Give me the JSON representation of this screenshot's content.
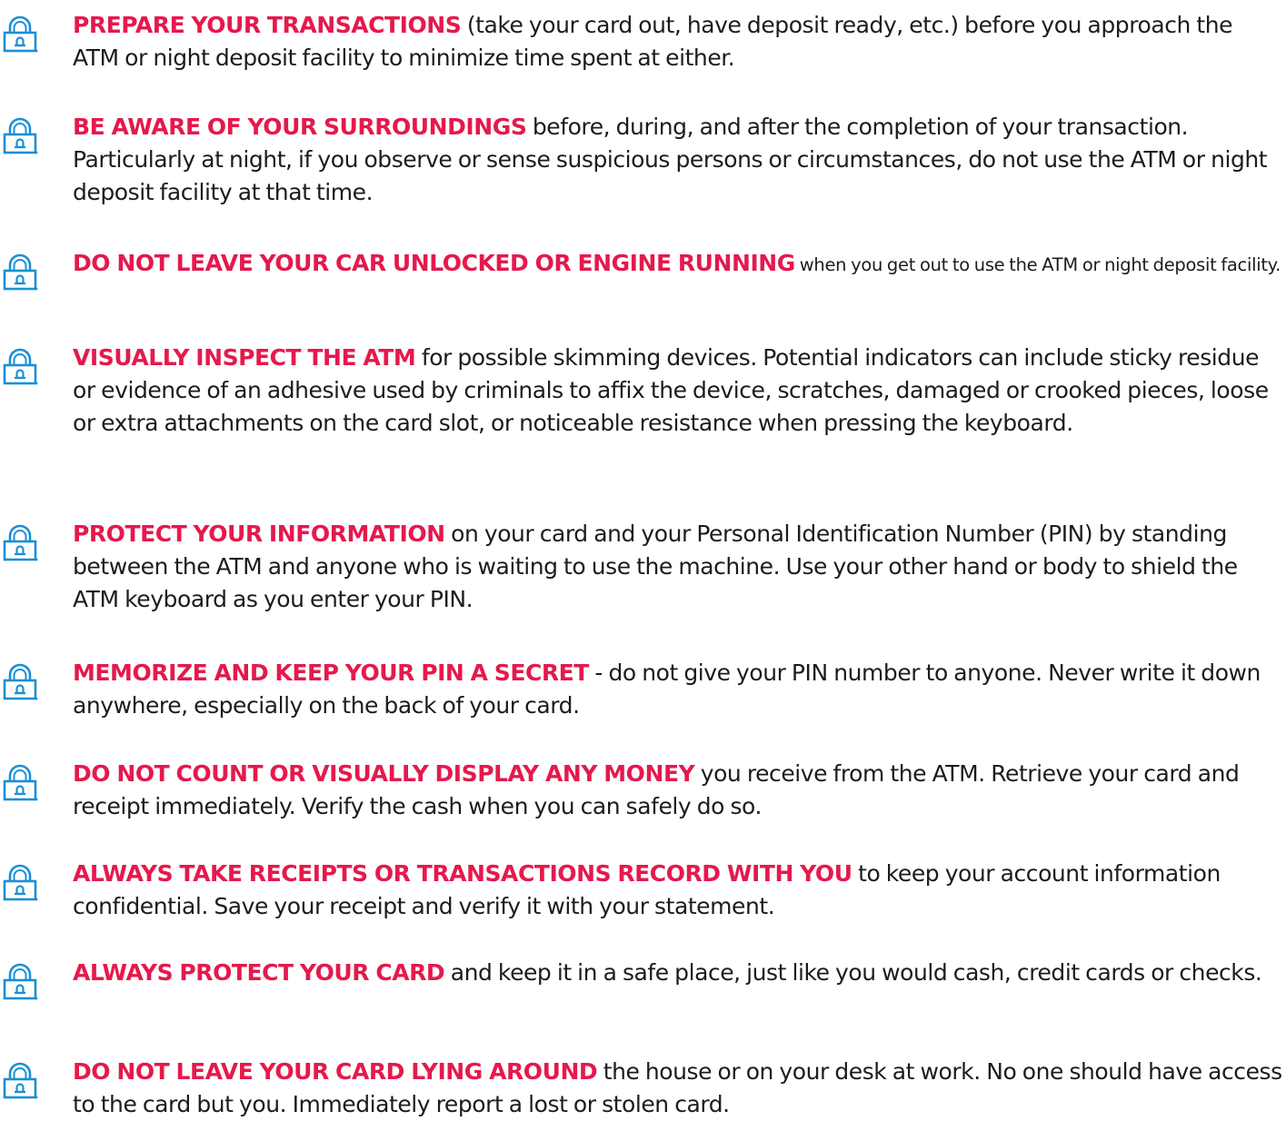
{
  "accent_color": "#e5194c",
  "icon_color": "#1a8fd6",
  "tips": [
    {
      "icon": "padlock-icon",
      "heading": "PREPARE YOUR TRANSACTIONS",
      "body": " (take your card out, have deposit ready, etc.) before you approach the ATM or night deposit facility to minimize time spent at either."
    },
    {
      "icon": "padlock-icon",
      "heading": "BE AWARE OF YOUR SURROUNDINGS",
      "body": " before, during, and after the completion of your transaction. Particularly at night, if you observe or sense suspicious persons or circumstances, do not use the ATM or night deposit facility at that time."
    },
    {
      "icon": "padlock-icon",
      "heading": "DO NOT LEAVE YOUR CAR UNLOCKED OR ENGINE RUNNING",
      "body": " when you get out to use the ATM or night deposit facility."
    },
    {
      "icon": "padlock-icon",
      "heading": "VISUALLY INSPECT THE ATM",
      "body": " for possible skimming devices. Potential indicators can include sticky residue or evidence of an adhesive used by criminals to affix the device, scratches, damaged or crooked pieces, loose or extra attachments on the card slot, or noticeable resistance when pressing the keyboard."
    },
    {
      "icon": "padlock-icon",
      "heading": "PROTECT YOUR INFORMATION",
      "body": " on your card and your Personal Identification Number (PIN) by standing between the ATM and anyone who is waiting to use the machine. Use your other hand or body to shield the ATM keyboard as you enter your PIN."
    },
    {
      "icon": "padlock-icon",
      "heading": "MEMORIZE AND KEEP YOUR PIN A SECRET",
      "body": " - do not give your PIN number to anyone. Never write it down anywhere, especially on the back of your card."
    },
    {
      "icon": "padlock-icon",
      "heading": "DO NOT COUNT OR VISUALLY DISPLAY ANY MONEY",
      "body": " you receive from the ATM. Retrieve your card and receipt immediately. Verify the cash when you can safely do so."
    },
    {
      "icon": "padlock-icon",
      "heading": "ALWAYS TAKE RECEIPTS OR TRANSACTIONS RECORD WITH YOU",
      "body": " to keep your account information confidential. Save your receipt and verify it with your statement."
    },
    {
      "icon": "padlock-icon",
      "heading": "ALWAYS PROTECT YOUR CARD",
      "body": " and keep it in a safe place, just like you would cash, credit cards or checks."
    },
    {
      "icon": "padlock-icon",
      "heading": "DO NOT LEAVE YOUR CARD LYING AROUND",
      "body": " the house or on your desk at work. No one should have access to the card but you. Immediately report a lost or stolen card."
    }
  ]
}
